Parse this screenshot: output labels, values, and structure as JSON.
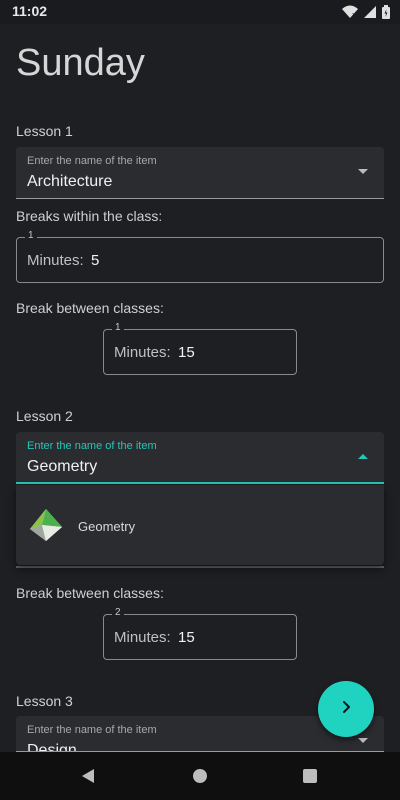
{
  "status": {
    "time": "11:02"
  },
  "title": "Sunday",
  "lesson1": {
    "label": "Lesson 1",
    "dropdown_label": "Enter the name of the item",
    "dropdown_value": "Architecture",
    "breaks_label": "Breaks within the class:",
    "breaks_field_label": "1",
    "breaks_prefix": "Minutes:",
    "breaks_value": "5",
    "between_label": "Break between classes:",
    "between_field_label": "1",
    "between_prefix": "Minutes:",
    "between_value": "15"
  },
  "lesson2": {
    "label": "Lesson 2",
    "dropdown_label": "Enter the name of the item",
    "dropdown_value": "Geometry",
    "menu_item": "Geometry",
    "between_label": "Break between classes:",
    "between_field_label": "2",
    "between_prefix": "Minutes:",
    "between_value": "15"
  },
  "lesson3": {
    "label": "Lesson 3",
    "dropdown_label": "Enter the name of the item",
    "dropdown_value": "Design"
  },
  "colors": {
    "accent": "#1fd3c0",
    "background": "#1e1f22",
    "field": "#2b2c30"
  },
  "icons": {
    "fab": "chevron-right-icon",
    "menu_item": "geometry-logo-icon"
  }
}
